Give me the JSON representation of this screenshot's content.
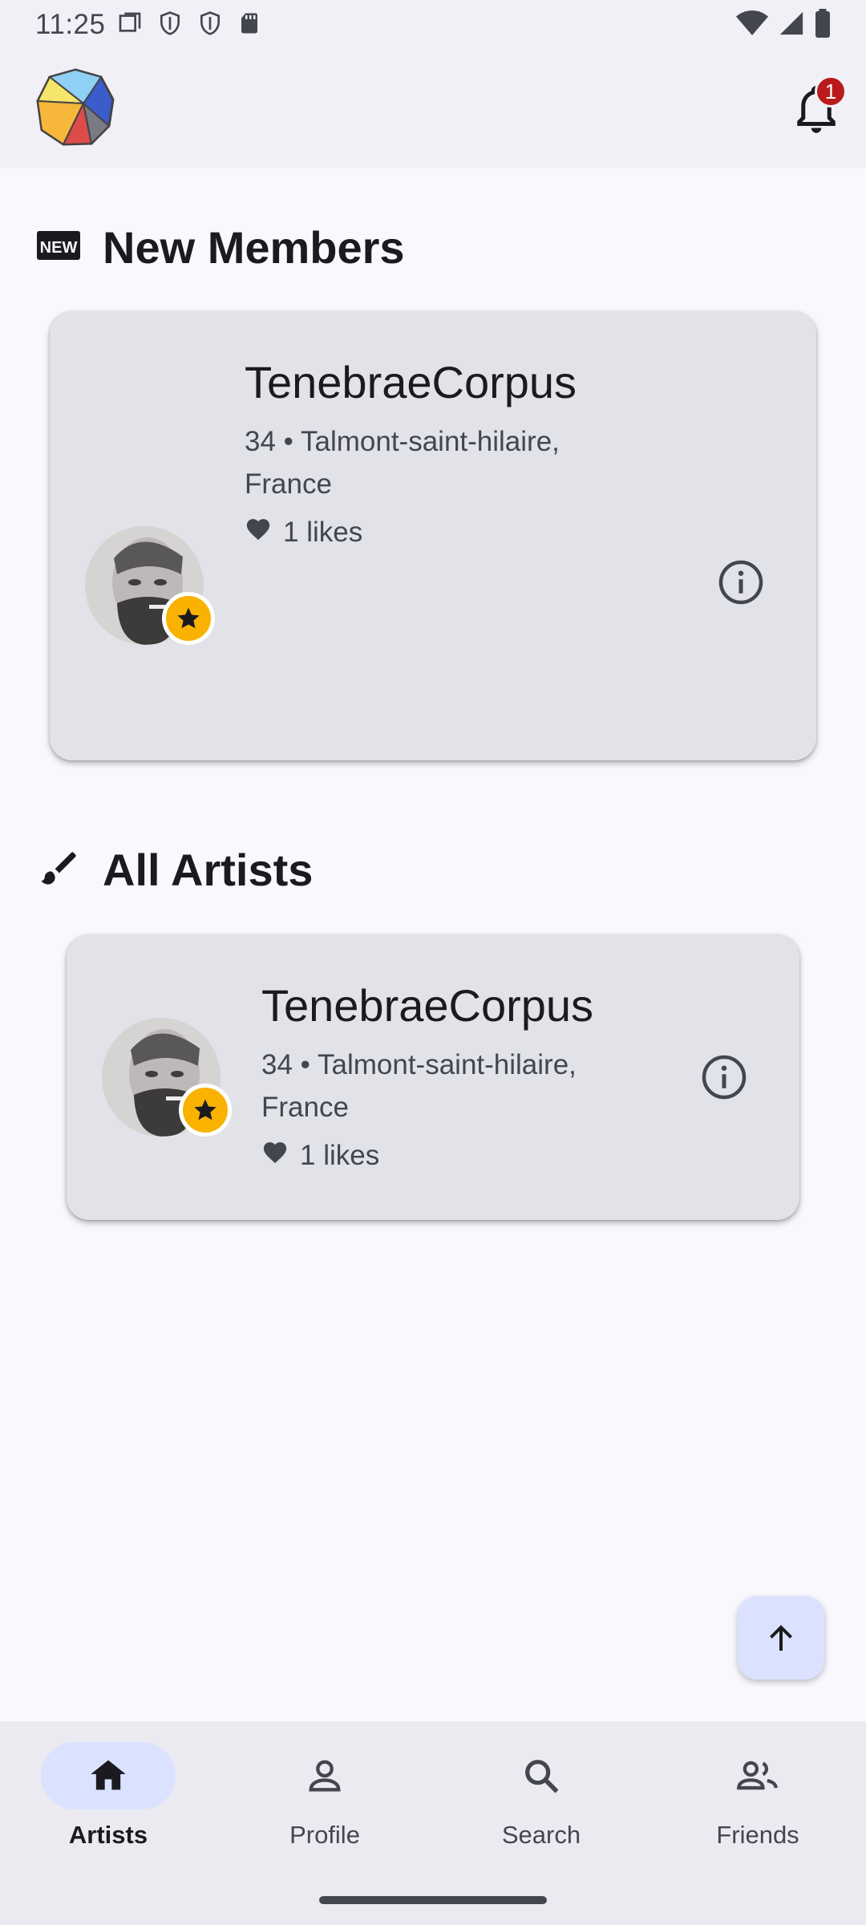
{
  "status_bar": {
    "time": "11:25",
    "icons_left": [
      "screen-icon",
      "shield-icon",
      "shield-icon",
      "sd-card-icon"
    ],
    "icons_right": [
      "wifi-icon",
      "signal-icon",
      "battery-icon"
    ]
  },
  "app_bar": {
    "notification_count": "1"
  },
  "sections": {
    "new_members": {
      "title": "New Members",
      "icon": "new-badge-icon",
      "card": {
        "name": "TenebraeCorpus",
        "location": "34 • Talmont-saint-hilaire, France",
        "likes": "1 likes"
      }
    },
    "all_artists": {
      "title": "All Artists",
      "icon": "brush-icon",
      "card": {
        "name": "TenebraeCorpus",
        "location": "34 • Talmont-saint-hilaire, France",
        "likes": "1 likes"
      }
    }
  },
  "nav": {
    "items": [
      {
        "label": "Artists",
        "icon": "home-icon",
        "active": true
      },
      {
        "label": "Profile",
        "icon": "person-icon",
        "active": false
      },
      {
        "label": "Search",
        "icon": "search-icon",
        "active": false
      },
      {
        "label": "Friends",
        "icon": "people-icon",
        "active": false
      }
    ]
  },
  "colors": {
    "accent": "#dae2ff",
    "badge": "#ba1a1a",
    "star": "#f9b200",
    "card": "#e2e2e9"
  }
}
